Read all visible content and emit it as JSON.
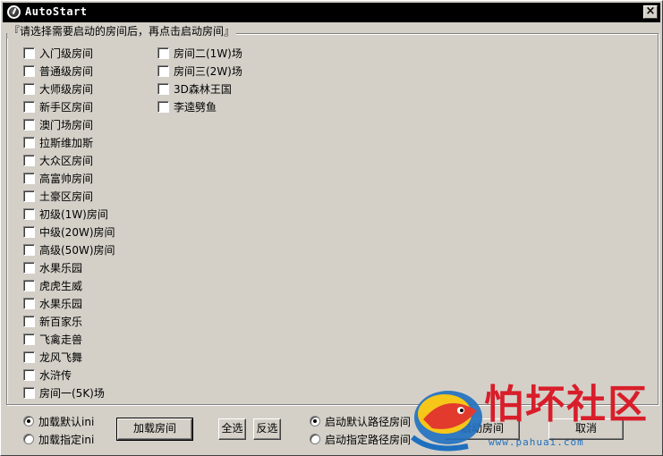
{
  "window": {
    "title": "AutoStart",
    "close_glyph": "×"
  },
  "group": {
    "title": "『请选择需要启动的房间后，再点击启动房间』"
  },
  "rooms_col1": [
    "入门级房间",
    "普通级房间",
    "大师级房间",
    "新手区房间",
    "澳门场房间",
    "拉斯维加斯",
    "大众区房间",
    "高富帅房间",
    "土豪区房间",
    "初级(1W)房间",
    "中级(20W)房间",
    "高级(50W)房间",
    "水果乐园",
    "虎虎生威",
    "水果乐园",
    "新百家乐",
    "飞禽走兽",
    "龙风飞舞",
    "水浒传",
    "房间一(5K)场"
  ],
  "rooms_col2": [
    "房间二(1W)场",
    "房间三(2W)场",
    "3D森林王国",
    "李逵劈鱼"
  ],
  "load_options": {
    "default": "加载默认ini",
    "custom": "加载指定ini",
    "selected": "default"
  },
  "buttons": {
    "load": "加载房间",
    "select_all": "全选",
    "invert": "反选",
    "start": "启动房间",
    "cancel": "取消"
  },
  "path_options": {
    "default": "启动默认路径房间",
    "custom": "启动指定路径房间",
    "selected": "default"
  },
  "watermark": {
    "text": "怕坏社区",
    "url": "www.pahuai.com"
  },
  "colors": {
    "titlebar": "#000000",
    "face": "#d4d0c8",
    "watermark_red": "#d81e2a",
    "watermark_blue": "#1f6fbf"
  }
}
